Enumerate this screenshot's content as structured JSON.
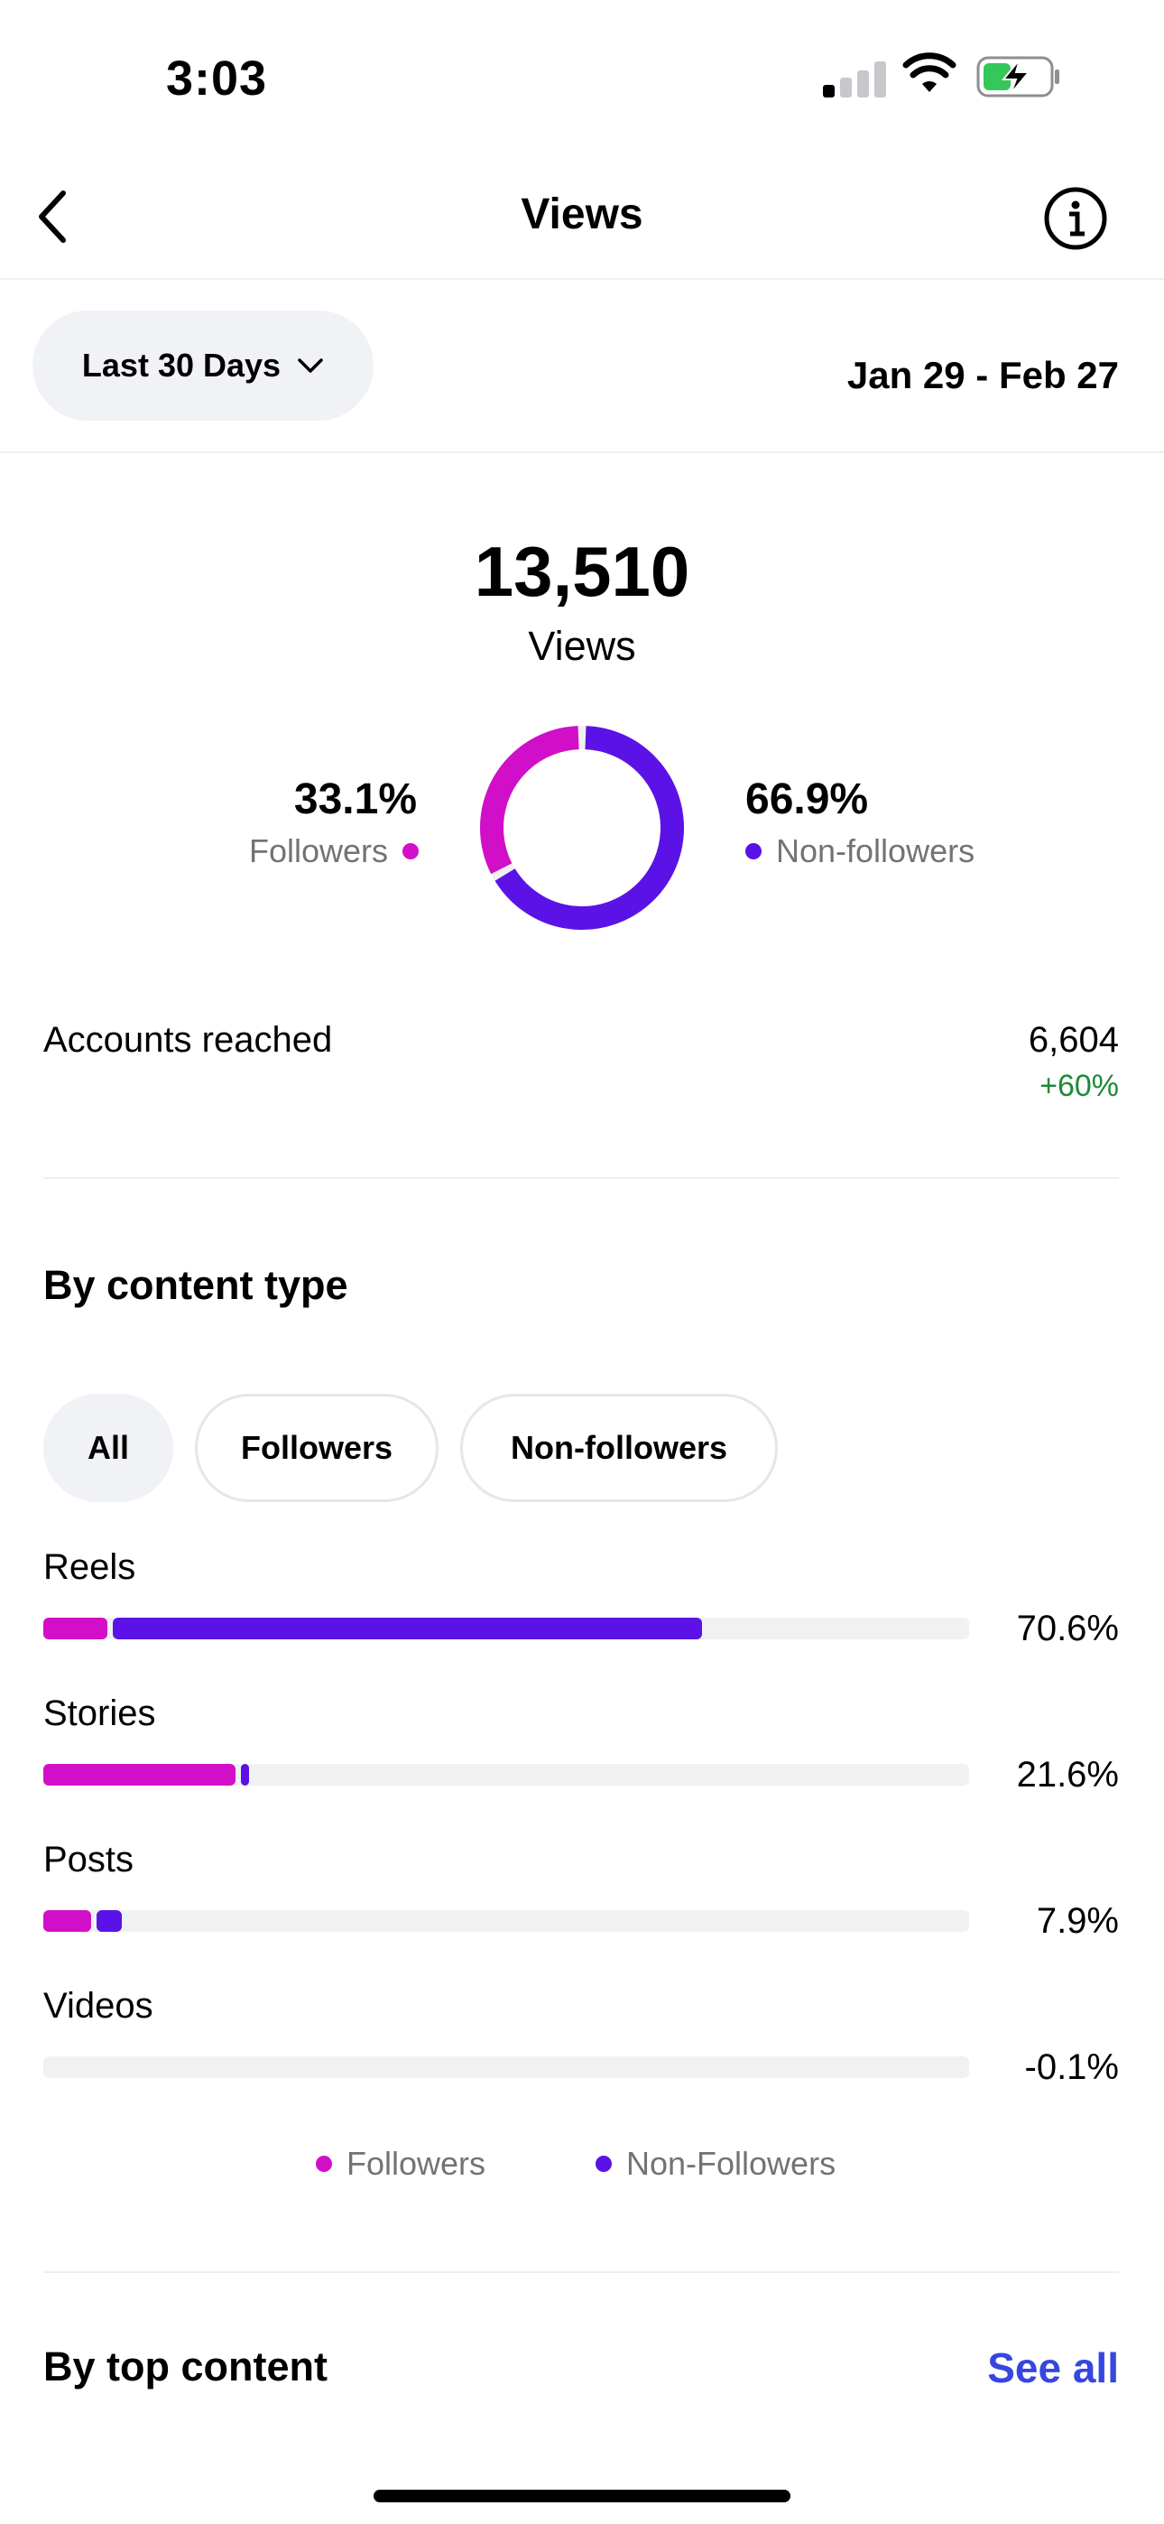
{
  "status_bar": {
    "time": "3:03"
  },
  "header": {
    "title": "Views"
  },
  "range": {
    "selector_label": "Last 30 Days",
    "dates": "Jan 29 - Feb 27"
  },
  "summary": {
    "total": "13,510",
    "total_label": "Views",
    "followers_pct": "33.1%",
    "followers_label": "Followers",
    "non_followers_pct": "66.9%",
    "non_followers_label": "Non-followers",
    "followers_fraction": 0.331
  },
  "accounts_reached": {
    "label": "Accounts reached",
    "value": "6,604",
    "change": "+60%"
  },
  "content_type": {
    "title": "By content type",
    "filters": [
      {
        "label": "All",
        "active": true
      },
      {
        "label": "Followers",
        "active": false
      },
      {
        "label": "Non-followers",
        "active": false
      }
    ],
    "rows": [
      {
        "label": "Reels",
        "pct": "70.6%",
        "followers": 0.069,
        "non_followers": 0.637
      },
      {
        "label": "Stories",
        "pct": "21.6%",
        "followers": 0.208,
        "non_followers": 0.008
      },
      {
        "label": "Posts",
        "pct": "7.9%",
        "followers": 0.052,
        "non_followers": 0.027
      },
      {
        "label": "Videos",
        "pct": "-0.1%",
        "followers": 0,
        "non_followers": 0
      }
    ],
    "legend": {
      "followers": "Followers",
      "non_followers": "Non-Followers"
    }
  },
  "top_content": {
    "title": "By top content",
    "see_all": "See all"
  },
  "colors": {
    "followers": "#d20fc8",
    "non_followers": "#5b12e6",
    "positive": "#1f8a3b",
    "link": "#3646e0"
  }
}
